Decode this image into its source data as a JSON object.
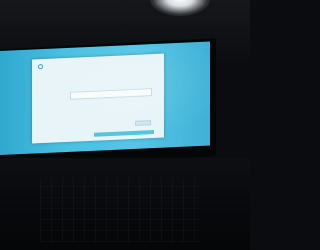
{
  "window": {
    "app_name": "",
    "subheading": "",
    "instruction": "",
    "field_value": "",
    "link_text": "",
    "button_label": "",
    "footer_text": ""
  },
  "colors": {
    "screen_background": "#49bfe2",
    "window_background": "#e7f4f8",
    "accent": "#2f9fc2"
  },
  "icons": {
    "app_logo": "circle-logo-icon"
  }
}
